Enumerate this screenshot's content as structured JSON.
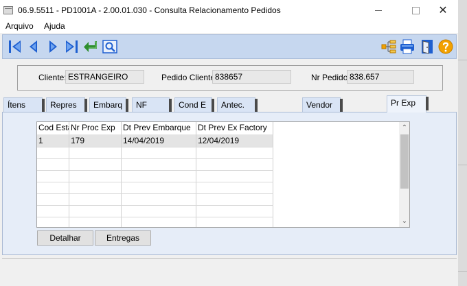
{
  "window": {
    "title": "06.9.5511 - PD1001A - 2.00.01.030 - Consulta Relacionamento Pedidos",
    "close_glyph": "✕"
  },
  "menu": [
    "Arquivo",
    "Ajuda"
  ],
  "toolbar": {
    "left_icons": [
      "first-record-icon",
      "previous-record-icon",
      "next-record-icon",
      "last-record-icon",
      "return-icon",
      "zoom-search-icon"
    ],
    "right_icons": [
      "tree-icon",
      "printer-icon",
      "exit-door-icon",
      "help-icon"
    ],
    "colors": {
      "bar": "#c6d7ef",
      "nav": "#1e5fd0",
      "return": "#2f8f2f",
      "help": "#f2a100"
    }
  },
  "header": {
    "cliente_label": "Cliente:",
    "cliente_value": "ESTRANGEIRO",
    "pedido_cliente_label": "Pedido Cliente:",
    "pedido_cliente_value": "838657",
    "nr_pedido_label": "Nr Pedido:",
    "nr_pedido_value": "838.657"
  },
  "tabs": [
    "Ítens",
    "Repres",
    "Embarq",
    "NF",
    "Cond E",
    "Antec.",
    "Vendor",
    "Pr Exp"
  ],
  "active_tab": "Pr Exp",
  "grid": {
    "columns": [
      "Cod Esta",
      "Nr Proc Exp",
      "Dt Prev Embarque",
      "Dt Prev Ex Factory"
    ],
    "rows": [
      [
        "1",
        "179",
        "14/04/2019",
        "12/04/2019"
      ]
    ],
    "scroll_up": "⌃",
    "scroll_down": "⌄"
  },
  "buttons": {
    "detalhar": "Detalhar",
    "entregas": "Entregas"
  }
}
